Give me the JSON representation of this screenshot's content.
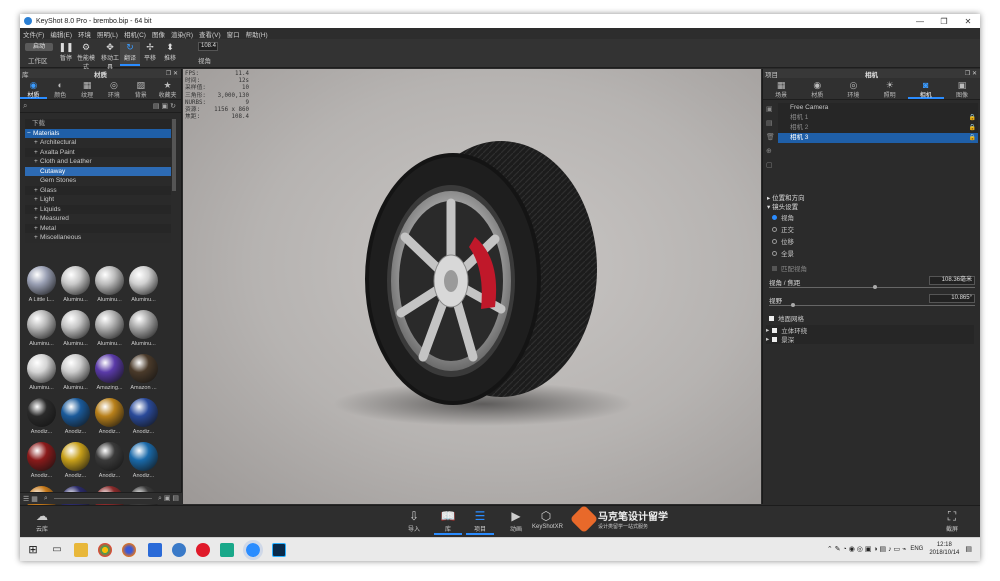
{
  "window": {
    "title": "KeyShot 8.0 Pro  -  brembo.bip  -  64 bit",
    "controls": [
      "—",
      "❐",
      "✕"
    ]
  },
  "menu": [
    "文件(F)",
    "编辑(E)",
    "环境",
    "照明(L)",
    "相机(C)",
    "图像",
    "渲染(R)",
    "查看(V)",
    "窗口",
    "帮助(H)"
  ],
  "ribbon": {
    "pill": "启动",
    "workspace": "工作区",
    "buttons": [
      {
        "label": "暂停",
        "glyph": "❚❚",
        "name": "pause-button"
      },
      {
        "label": "性能模式",
        "glyph": "⚙",
        "name": "performance-mode-button"
      },
      {
        "label": "移动工具",
        "glyph": "✥",
        "name": "move-tool-button"
      },
      {
        "label": "翻译",
        "glyph": "↻",
        "name": "tumble-button",
        "active": true
      },
      {
        "label": "平移",
        "glyph": "✢",
        "name": "pan-button"
      },
      {
        "label": "推移",
        "glyph": "⬍",
        "name": "dolly-button"
      }
    ],
    "zoom_value": "108.4",
    "view_label": "视角"
  },
  "library": {
    "panel_label": "库",
    "title": "材质",
    "tabs": [
      {
        "label": "材质",
        "glyph": "◉"
      },
      {
        "label": "颜色",
        "glyph": "◐"
      },
      {
        "label": "纹理",
        "glyph": "▦"
      },
      {
        "label": "环境",
        "glyph": "◎"
      },
      {
        "label": "背景",
        "glyph": "▨"
      },
      {
        "label": "收藏夹",
        "glyph": "★"
      }
    ],
    "tree_header": "下载",
    "tree": [
      {
        "label": "Materials",
        "state": "sel",
        "indent": 0,
        "exp": "−"
      },
      {
        "label": "Architectural",
        "indent": 1,
        "exp": "+"
      },
      {
        "label": "Axalta Paint",
        "indent": 1,
        "exp": "+"
      },
      {
        "label": "Cloth and Leather",
        "indent": 1,
        "exp": "+"
      },
      {
        "label": "Cutaway",
        "indent": 1,
        "state": "cut",
        "exp": ""
      },
      {
        "label": "Gem Stones",
        "indent": 1,
        "exp": ""
      },
      {
        "label": "Glass",
        "indent": 1,
        "exp": "+"
      },
      {
        "label": "Light",
        "indent": 1,
        "exp": "+"
      },
      {
        "label": "Liquids",
        "indent": 1,
        "exp": "+"
      },
      {
        "label": "Measured",
        "indent": 1,
        "exp": "+"
      },
      {
        "label": "Metal",
        "indent": 1,
        "exp": "+"
      },
      {
        "label": "Miscellaneous",
        "indent": 1,
        "exp": "+"
      }
    ],
    "thumbnails": [
      {
        "label": "A Little L...",
        "color": "#9aa0b4"
      },
      {
        "label": "Aluminu...",
        "color": "#c8c8c8"
      },
      {
        "label": "Aluminu...",
        "color": "#bcbcbc"
      },
      {
        "label": "Aluminu...",
        "color": "#d0d0d0"
      },
      {
        "label": "Aluminu...",
        "color": "#b8b8b8"
      },
      {
        "label": "Aluminu...",
        "color": "#c4c4c4"
      },
      {
        "label": "Aluminu...",
        "color": "#b0b0b0"
      },
      {
        "label": "Aluminu...",
        "color": "#a8a8a8"
      },
      {
        "label": "Aluminu...",
        "color": "#d4d4d4"
      },
      {
        "label": "Aluminu...",
        "color": "#cccccc"
      },
      {
        "label": "Amazing...",
        "color": "#5a3aa8"
      },
      {
        "label": "Amazon ...",
        "color": "#4a3a2a"
      },
      {
        "label": "Anodiz...",
        "color": "#2a2a2a"
      },
      {
        "label": "Anodiz...",
        "color": "#1a5a9a"
      },
      {
        "label": "Anodiz...",
        "color": "#b8801a"
      },
      {
        "label": "Anodiz...",
        "color": "#2a4a9a"
      },
      {
        "label": "Anodiz...",
        "color": "#8a1a1a"
      },
      {
        "label": "Anodiz...",
        "color": "#c8a01a"
      },
      {
        "label": "Anodiz...",
        "color": "#3a3a3a"
      },
      {
        "label": "Anodiz...",
        "color": "#1a6aaa"
      },
      {
        "label": "",
        "color": "#c87a1a"
      },
      {
        "label": "",
        "color": "#2a2a6a"
      },
      {
        "label": "",
        "color": "#8a2a2a"
      },
      {
        "label": "",
        "color": "#3a3a3a"
      }
    ]
  },
  "hud": [
    {
      "k": "FPS:",
      "v": "11.4"
    },
    {
      "k": "时间:",
      "v": "12s"
    },
    {
      "k": "采样值:",
      "v": "10"
    },
    {
      "k": "三角形:",
      "v": "3,000,130"
    },
    {
      "k": "NURBS:",
      "v": "9"
    },
    {
      "k": "资源:",
      "v": "1156 x 860"
    },
    {
      "k": "焦距:",
      "v": "108.4"
    }
  ],
  "project": {
    "panel_label": "项目",
    "title": "相机",
    "tabs": [
      {
        "label": "场景",
        "glyph": "▦"
      },
      {
        "label": "材质",
        "glyph": "◉"
      },
      {
        "label": "环境",
        "glyph": "◎"
      },
      {
        "label": "照明",
        "glyph": "☀"
      },
      {
        "label": "相机",
        "glyph": "◙",
        "sel": true
      },
      {
        "label": "图像",
        "glyph": "▣"
      }
    ],
    "cameras": [
      {
        "label": "Free Camera",
        "state": "normal",
        "lock": ""
      },
      {
        "label": "相机 1",
        "state": "dim",
        "lock": "🔒"
      },
      {
        "label": "相机 2",
        "state": "dim",
        "lock": "🔒"
      },
      {
        "label": "相机 3",
        "state": "sel",
        "lock": "🔒"
      }
    ],
    "sec_position": "▸ 位置和方向",
    "sec_lens": "▾ 镜头设置",
    "radios": [
      {
        "label": "视角",
        "on": true
      },
      {
        "label": "正交",
        "on": false
      },
      {
        "label": "位移",
        "on": false
      },
      {
        "label": "全景",
        "on": false
      }
    ],
    "match_view": "匹配视角",
    "fov_label": "视角 / 焦距",
    "fov_value": "108.36毫米",
    "view_label": "视野",
    "view_value": "10.865°",
    "shift_label": "地面网格",
    "stereo": "立体环绕",
    "dof": "景深"
  },
  "bottombar": [
    {
      "label": "云库",
      "glyph": "☁",
      "name": "cloud-library-button"
    },
    {
      "label": "导入",
      "glyph": "⇩",
      "name": "import-button"
    },
    {
      "label": "库",
      "glyph": "📖",
      "name": "library-button",
      "on": true
    },
    {
      "label": "项目",
      "glyph": "☰",
      "name": "project-button",
      "on": true
    },
    {
      "label": "动画",
      "glyph": "▶",
      "name": "animation-button"
    },
    {
      "label": "KeyShotXR",
      "glyph": "⬡",
      "name": "keyshotxr-button"
    },
    {
      "label": "截屏",
      "glyph": "⛶",
      "name": "screenshot-button"
    }
  ],
  "watermark": {
    "title": "马克笔设计留学",
    "sub": "设计类留学一站式服务"
  },
  "taskbar": {
    "lang": "ENG",
    "time": "12:18",
    "date": "2018/10/14"
  },
  "colors": {
    "accent": "#2a8cff",
    "selection": "#1f5fa8",
    "bg": "#2b2b2b"
  }
}
